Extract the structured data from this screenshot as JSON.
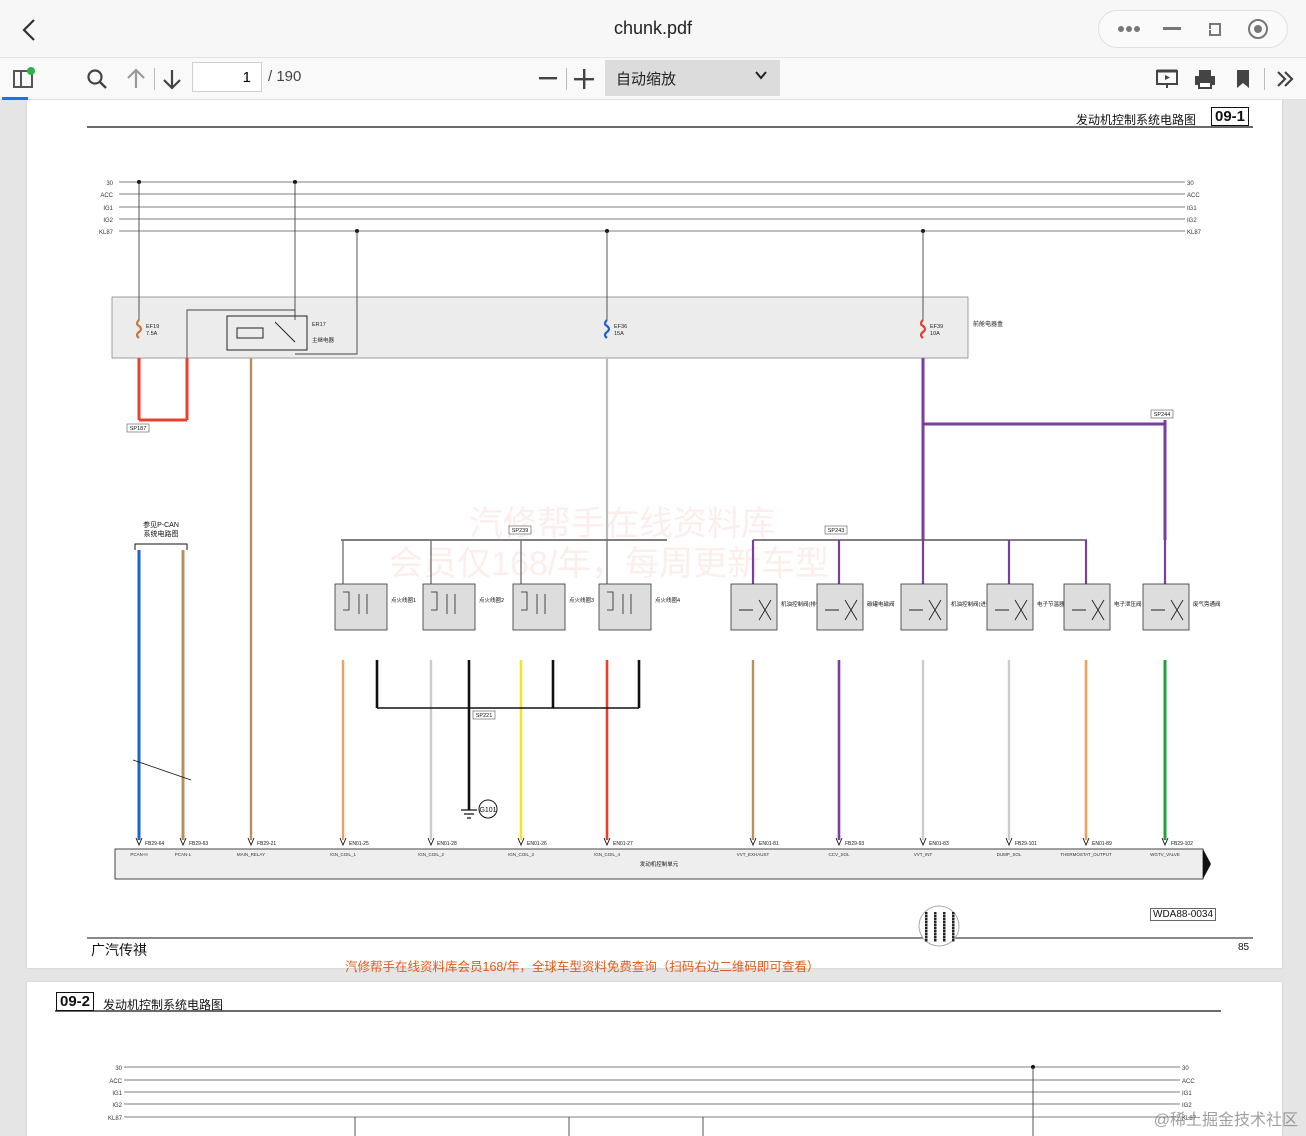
{
  "window": {
    "title": "chunk.pdf",
    "controls": [
      "more-icon",
      "minimize-icon",
      "restore-icon",
      "record-icon"
    ]
  },
  "toolbar": {
    "page_current": "1",
    "page_total": "/ 190",
    "zoom_label": "自动缩放"
  },
  "page1": {
    "header_title": "发动机控制系统电路图",
    "header_code": "09-1",
    "footer_brand": "广汽传祺",
    "footer_note": "汽修帮手在线资料库会员168/年，全球车型资料免费查询（扫码右边二维码即可查看）",
    "page_number": "85",
    "diagram_code": "WDA88-0034",
    "watermark_line1": "汽修帮手在线资料库",
    "watermark_line2": "会员仅168/年，每周更新车型"
  },
  "page2": {
    "header_code": "09-2",
    "header_title": "发动机控制系统电路图"
  },
  "rails_left": [
    "30",
    "ACC",
    "IG1",
    "IG2",
    "KL87"
  ],
  "rails_right": [
    "30",
    "ACC",
    "IG1",
    "IG2",
    "KL87"
  ],
  "fuses": [
    {
      "id": "EF19",
      "amp": "7.5A"
    },
    {
      "id": "EF36",
      "amp": "15A"
    },
    {
      "id": "EF39",
      "amp": "10A"
    }
  ],
  "relay": {
    "id": "ER17",
    "desc": "主继电器"
  },
  "fuse_box_label": "前舱电器盒",
  "pcan_label_1": "参见P-CAN",
  "pcan_label_2": "系统电路图",
  "splices": [
    "SP187",
    "SP239",
    "SP243",
    "SP244",
    "SP221"
  ],
  "ground": "G101",
  "coils": [
    "点火线圈1",
    "点火线圈2",
    "点火线圈3",
    "点火线圈4"
  ],
  "valves": [
    "机油控制阀(排气侧)",
    "碳罐电磁阀",
    "机油控制阀(进气侧)",
    "电子节温器控制阀",
    "电子泄压阀",
    "废气旁通阀"
  ],
  "ecu_label": "发动机控制单元",
  "ecu_pins": [
    "PCAN-H",
    "PCAN-L",
    "MAIN_RELAY",
    "IGN_COIL_1",
    "IGN_COIL_2",
    "IGN_COIL_3",
    "IGN_COIL_4",
    "VVT_EXHAUST",
    "CCV_SOL",
    "VVT_INT",
    "DUMP_SOL",
    "THERMOSTAT_OUTPUT",
    "WGTV_VALVE"
  ],
  "bottom_connectors": [
    "FB29-64",
    "FB29-63",
    "FB29-21",
    "EN01-25",
    "EN01-28",
    "EN01-26",
    "EN01-27",
    "EN01-81",
    "FB29-93",
    "EN01-83",
    "FB29-101",
    "EN01-89",
    "FB29-102"
  ],
  "colors": {
    "red": "#e8402a",
    "purple": "#7a3f9e",
    "tan": "#b89060",
    "orange": "#f0a060",
    "yellow": "#f5e32a",
    "green": "#22a040",
    "blue": "#1a66c8",
    "black": "#111111"
  },
  "corner_watermark": "@稀土掘金技术社区"
}
